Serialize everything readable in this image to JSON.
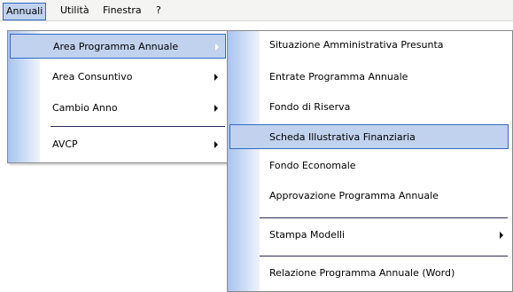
{
  "menubar": {
    "items": [
      {
        "label": "Annuali"
      },
      {
        "label": "Utilità"
      },
      {
        "label": "Finestra"
      },
      {
        "label": "?"
      }
    ]
  },
  "main_menu": {
    "items": [
      {
        "label": "Area Programma Annuale"
      },
      {
        "label": "Area Consuntivo"
      },
      {
        "label": "Cambio Anno"
      },
      {
        "label": "AVCP"
      }
    ]
  },
  "submenu": {
    "items": [
      {
        "label": "Situazione Amministrativa Presunta"
      },
      {
        "label": "Entrate Programma Annuale"
      },
      {
        "label": "Fondo di Riserva"
      },
      {
        "label": "Scheda Illustrativa Finanziaria"
      },
      {
        "label": "Fondo Economale"
      },
      {
        "label": "Approvazione Programma Annuale"
      },
      {
        "label": "Stampa Modelli"
      },
      {
        "label": "Relazione Programma Annuale (Word)"
      }
    ]
  },
  "colors": {
    "highlight_fill": "#c1d2ee",
    "highlight_border": "#316ac5",
    "separator": "#2b2b55"
  }
}
